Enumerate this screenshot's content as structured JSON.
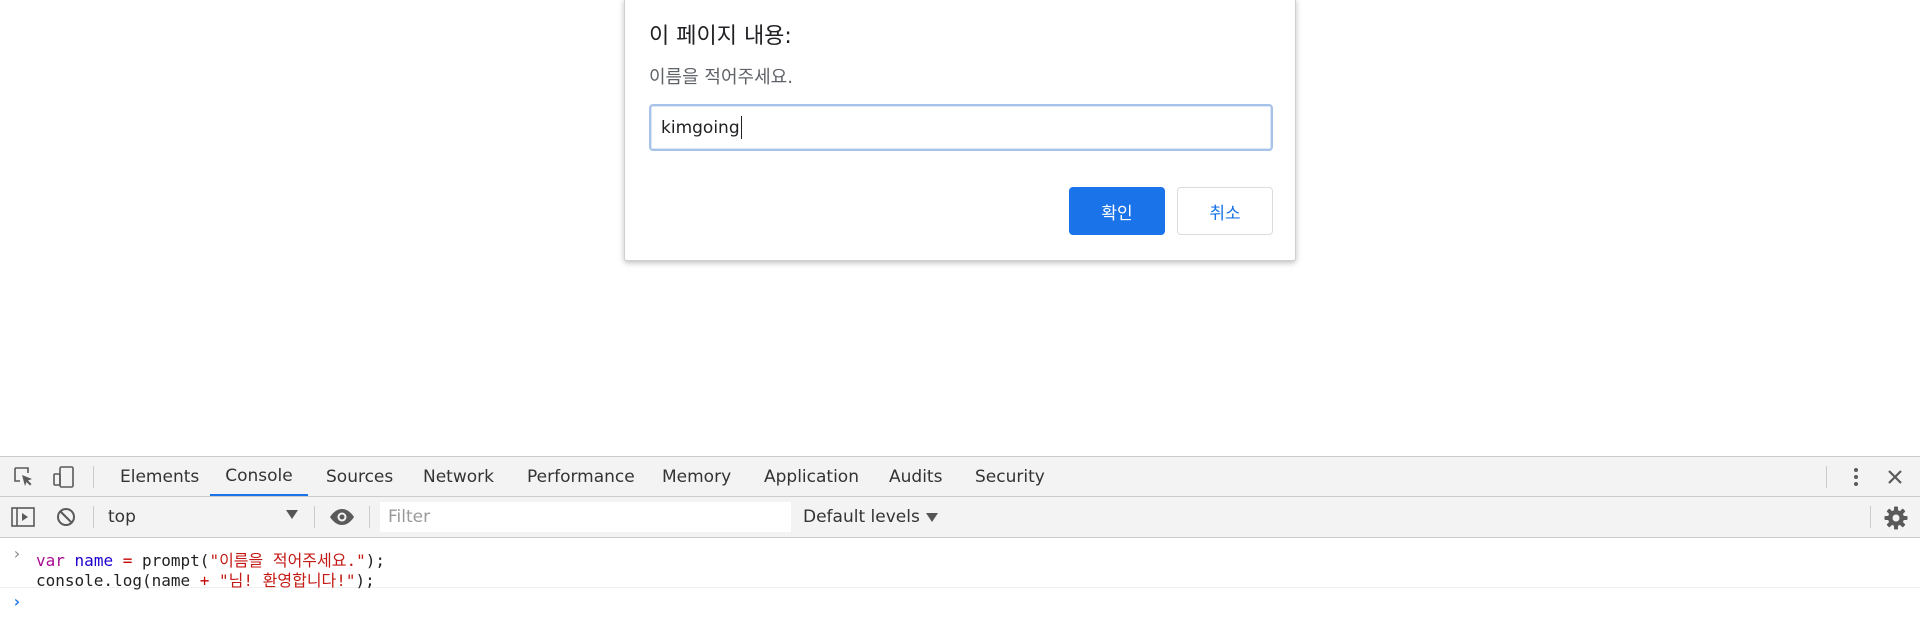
{
  "dialog": {
    "title": "이 페이지 내용:",
    "message": "이름을 적어주세요.",
    "input_value": "kimgoing",
    "ok_label": "확인",
    "cancel_label": "취소",
    "accent_color": "#1a73e8"
  },
  "devtools": {
    "left_icons": [
      "inspect-element-icon",
      "device-toolbar-icon"
    ],
    "tabs": [
      {
        "label": "Elements",
        "active": false
      },
      {
        "label": "Console",
        "active": true
      },
      {
        "label": "Sources",
        "active": false
      },
      {
        "label": "Network",
        "active": false
      },
      {
        "label": "Performance",
        "active": false
      },
      {
        "label": "Memory",
        "active": false
      },
      {
        "label": "Application",
        "active": false
      },
      {
        "label": "Audits",
        "active": false
      },
      {
        "label": "Security",
        "active": false
      }
    ],
    "right_icons": [
      "more-options-icon",
      "close-icon"
    ],
    "toolbar": {
      "context_value": "top",
      "filter_placeholder": "Filter",
      "levels_label": "Default levels",
      "icons": [
        "sidebar-toggle-icon",
        "clear-console-icon",
        "live-expression-icon",
        "settings-gear-icon"
      ]
    },
    "console": {
      "line1": {
        "kw": "var",
        "name": "name",
        "eq": "=",
        "call": "prompt(",
        "arg": "\"이름을 적어주세요.\"",
        "end": ");"
      },
      "line2": {
        "start": "console.log(name ",
        "plus": "+",
        "arg": "\"님! 환영합니다!\"",
        "end": ");"
      }
    }
  }
}
